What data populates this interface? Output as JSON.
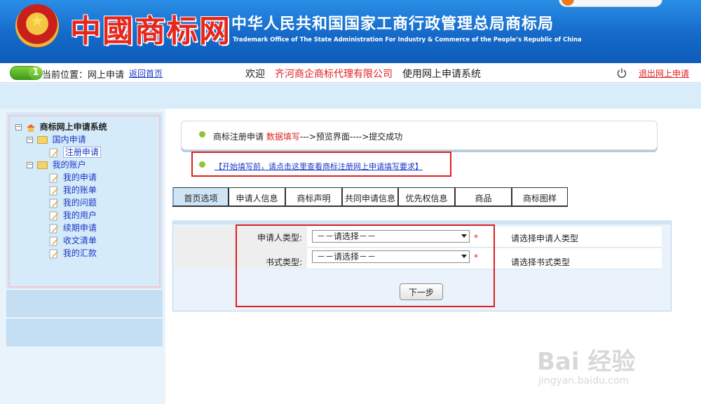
{
  "header": {
    "logo_text": "中國商标网",
    "title": "中华人民共和国国家工商行政管理总局商标局",
    "subtitle": "Trademark Office of The State Administration For Industry & Commerce of the People’s Republic of China"
  },
  "nav": {
    "step_badge": "1",
    "location": "当前位置：网上申请",
    "back_home": "返回首页",
    "welcome": "欢迎",
    "company": "齐河商企商标代理有限公司",
    "system": "使用网上申请系统",
    "logout": "退出网上申请"
  },
  "sidebar": {
    "root": "商标网上申请系统",
    "domestic": "国内申请",
    "register": "注册申请",
    "account": "我的账户",
    "items": [
      "我的申请",
      "我的账单",
      "我的问题",
      "我的用户",
      "续期申请",
      "收文清单",
      "我的汇款"
    ]
  },
  "crumb": {
    "step1": "商标注册申请",
    "step2": "数据填写",
    "step3": "--->预览界面---->提交成功"
  },
  "notice": {
    "link": "【开始填写前，请点击这里查看商标注册网上申请填写要求】"
  },
  "tabs": [
    "首页选项",
    "申请人信息",
    "商标声明",
    "共同申请信息",
    "优先权信息",
    "商品",
    "商标图样"
  ],
  "form": {
    "applicant_type_label": "申请人类型:",
    "applicant_type_value": "－－请选择－－",
    "applicant_type_hint": "请选择申请人类型",
    "book_type_label": "书式类型:",
    "book_type_value": "－－请选择－－",
    "book_type_hint": "请选择书式类型",
    "required_mark": "*",
    "next_button": "下一步"
  },
  "watermark": {
    "brand": "Bai 经验",
    "url": "jingyan.baidu.com"
  },
  "colors": {
    "header_blue": "#1569c9",
    "accent_red": "#e02020",
    "link_blue": "#1a37c8",
    "dot_green": "#8fc43a"
  }
}
